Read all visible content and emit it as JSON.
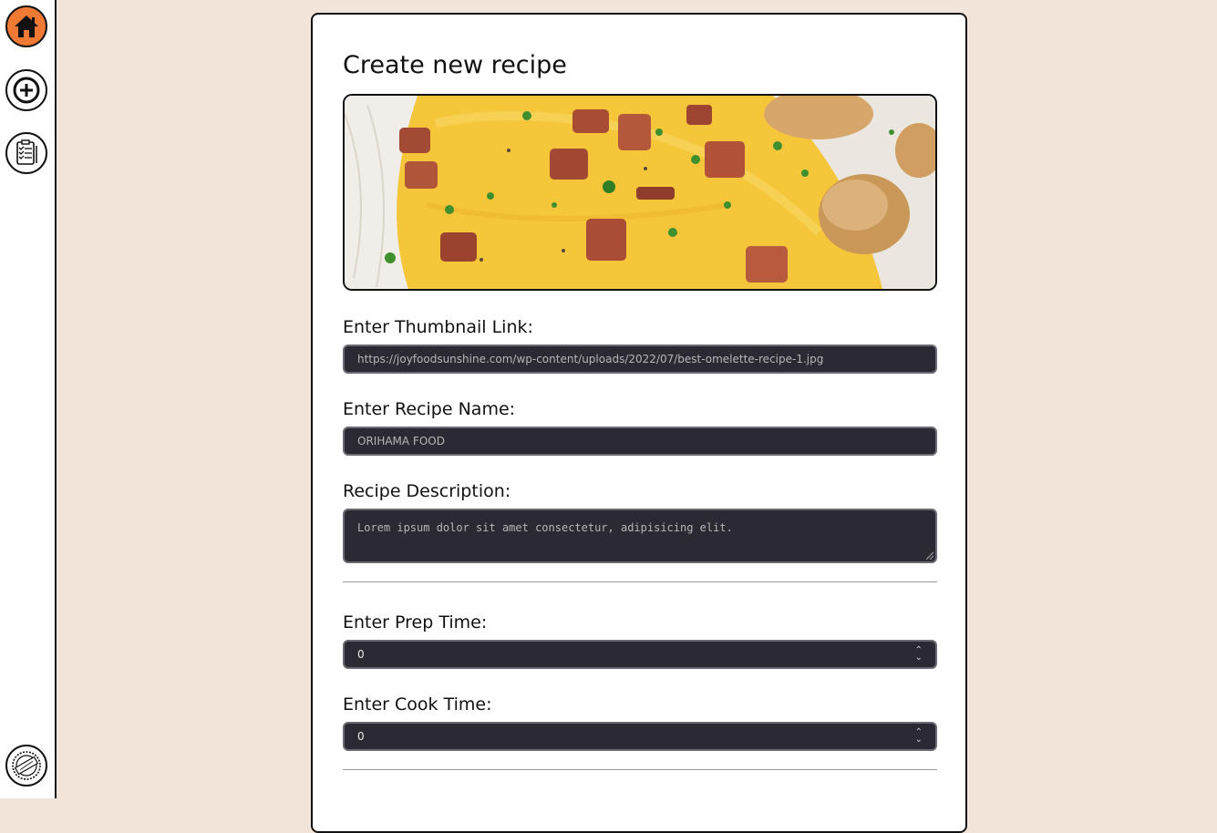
{
  "page": {
    "title": "Create new recipe"
  },
  "form": {
    "thumbnail": {
      "label": "Enter Thumbnail Link:",
      "value": "https://joyfoodsunshine.com/wp-content/uploads/2022/07/best-omelette-recipe-1.jpg"
    },
    "name": {
      "label": "Enter Recipe Name:",
      "value": "ORIHAMA FOOD"
    },
    "description": {
      "label": "Recipe Description:",
      "value": "Lorem ipsum dolor sit amet consectetur, adipisicing elit."
    },
    "prep_time": {
      "label": "Enter Prep Time:",
      "value": "0"
    },
    "cook_time": {
      "label": "Enter Cook Time:",
      "value": "0"
    }
  },
  "sidebar": {
    "items": [
      {
        "icon": "home-icon"
      },
      {
        "icon": "add-circle-icon"
      },
      {
        "icon": "recipe-list-icon"
      },
      {
        "icon": "original-badge-icon"
      }
    ]
  },
  "colors": {
    "background": "#f2e4d8",
    "home_accent": "#f07a33",
    "input_bg": "#2b2a33"
  }
}
